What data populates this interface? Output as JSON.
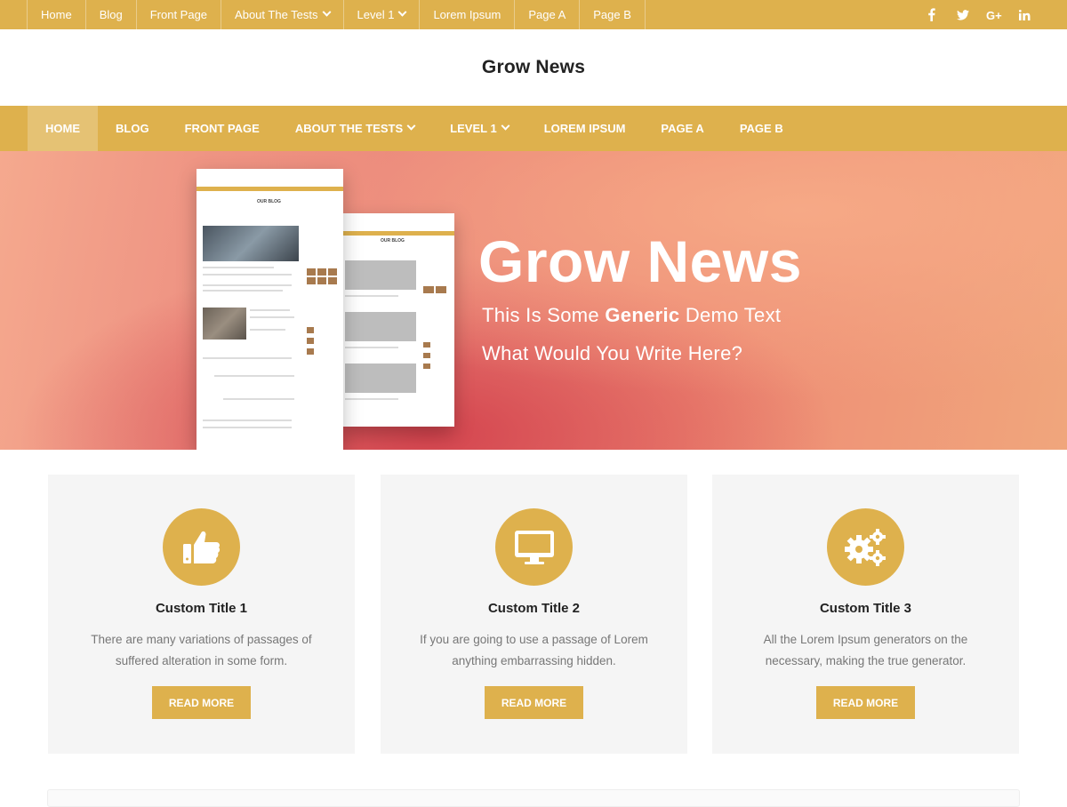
{
  "top_menu": {
    "items": [
      {
        "label": "Home"
      },
      {
        "label": "Blog"
      },
      {
        "label": "Front Page"
      },
      {
        "label": "About The Tests",
        "has_dropdown": true
      },
      {
        "label": "Level 1",
        "has_dropdown": true
      },
      {
        "label": "Lorem Ipsum"
      },
      {
        "label": "Page A"
      },
      {
        "label": "Page B"
      }
    ],
    "social": [
      {
        "name": "facebook-icon",
        "glyph": "f"
      },
      {
        "name": "twitter-icon",
        "glyph": "t"
      },
      {
        "name": "google-plus-icon",
        "glyph": "G+"
      },
      {
        "name": "linkedin-icon",
        "glyph": "in"
      }
    ]
  },
  "header": {
    "site_title": "Grow News"
  },
  "main_menu": {
    "items": [
      {
        "label": "Home",
        "active": true
      },
      {
        "label": "Blog"
      },
      {
        "label": "Front Page"
      },
      {
        "label": "About The Tests",
        "has_dropdown": true
      },
      {
        "label": "Level 1",
        "has_dropdown": true
      },
      {
        "label": "Lorem Ipsum"
      },
      {
        "label": "Page A"
      },
      {
        "label": "Page B"
      }
    ]
  },
  "hero": {
    "title": "Grow News",
    "line1_before": "This Is Some ",
    "line1_bold": "Generic",
    "line1_after": " Demo Text",
    "line2": "What Would You Write Here?",
    "mockup_heading": "OUR BLOG"
  },
  "features": [
    {
      "icon": "thumbs-up-icon",
      "title": "Custom Title 1",
      "text": "There are many variations of passages of suffered alteration in some form.",
      "button": "Read More"
    },
    {
      "icon": "desktop-icon",
      "title": "Custom Title 2",
      "text": "If you are going to use a passage of Lorem anything embarrassing hidden.",
      "button": "Read More"
    },
    {
      "icon": "gears-icon",
      "title": "Custom Title 3",
      "text": "All the Lorem Ipsum generators on the necessary, making the true generator.",
      "button": "Read More"
    }
  ],
  "colors": {
    "accent": "#deb14d",
    "card_bg": "#f5f5f5",
    "text_muted": "#777777"
  }
}
